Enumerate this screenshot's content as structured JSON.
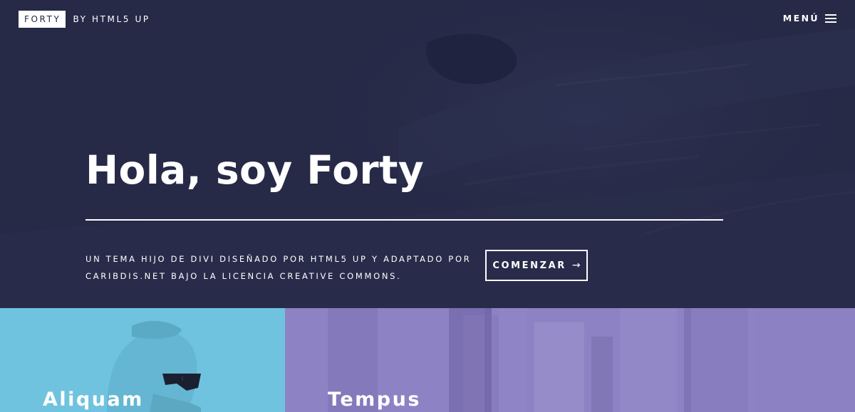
{
  "header": {
    "logo_box": "FORTY",
    "logo_rest": "BY HTML5 UP",
    "menu_label": "MENÚ",
    "menu_icon": "hamburger-icon"
  },
  "banner": {
    "title": "Hola, soy Forty",
    "description": "UN TEMA HIJO DE DIVI DISEÑADO POR HTML5 UP Y ADAPTADO POR CARIBDIS.NET BAJO LA LICENCIA CREATIVE COMMONS.",
    "button_label": "COMENZAR",
    "button_icon": "arrow-right-icon",
    "overlay_color": "#242943"
  },
  "tiles": [
    {
      "title": "Aliquam",
      "color": "#6fc3df"
    },
    {
      "title": "Tempus",
      "color": "#8d82c4"
    }
  ]
}
